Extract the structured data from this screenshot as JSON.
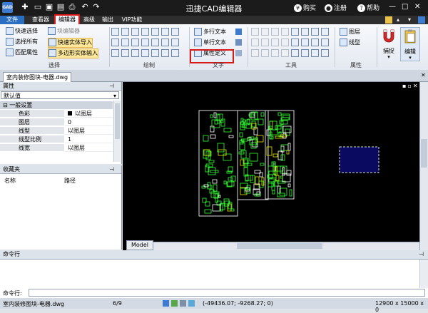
{
  "titlebar": {
    "title": "迅捷CAD编辑器",
    "logo": "GAD",
    "buy": "购买",
    "register": "注册",
    "help": "帮助"
  },
  "tabs": [
    "文件",
    "查看器",
    "编辑器",
    "高级",
    "输出",
    "VIP功能"
  ],
  "ribbon": {
    "select": {
      "label": "选择",
      "items": [
        "快速选择",
        "选择所有",
        "匹配属性",
        "块编辑器",
        "快速实体导入",
        "多边形实体输入"
      ]
    },
    "draw": {
      "label": "绘制"
    },
    "text": {
      "label": "文字",
      "items": [
        "多行文本",
        "单行文本",
        "属性定义"
      ]
    },
    "tools": {
      "label": "工具"
    },
    "props": {
      "label": "属性",
      "items": [
        "图层",
        "线型"
      ]
    },
    "capture": "捕捉",
    "edit": "编辑"
  },
  "doc_tab": "室内装修图块-电器.dwg",
  "properties": {
    "header": "属性",
    "dropdown": "默认值",
    "section": "一般设置",
    "rows": [
      {
        "k": "色彩",
        "v": "以图层"
      },
      {
        "k": "图层",
        "v": "0"
      },
      {
        "k": "线型",
        "v": "以图层"
      },
      {
        "k": "线型比例",
        "v": "1"
      },
      {
        "k": "线宽",
        "v": "以图层"
      }
    ]
  },
  "favorites": {
    "header": "收藏夹",
    "col_name": "名称",
    "col_path": "路径"
  },
  "model_tab": "Model",
  "command": {
    "header": "命令行",
    "prompt": "命令行:"
  },
  "status": {
    "file": "室内装修图块-电器.dwg",
    "pages": "6/9",
    "coords": "(-49436.07; -9268.27; 0)",
    "size": "12900 x 15000 x 0"
  }
}
